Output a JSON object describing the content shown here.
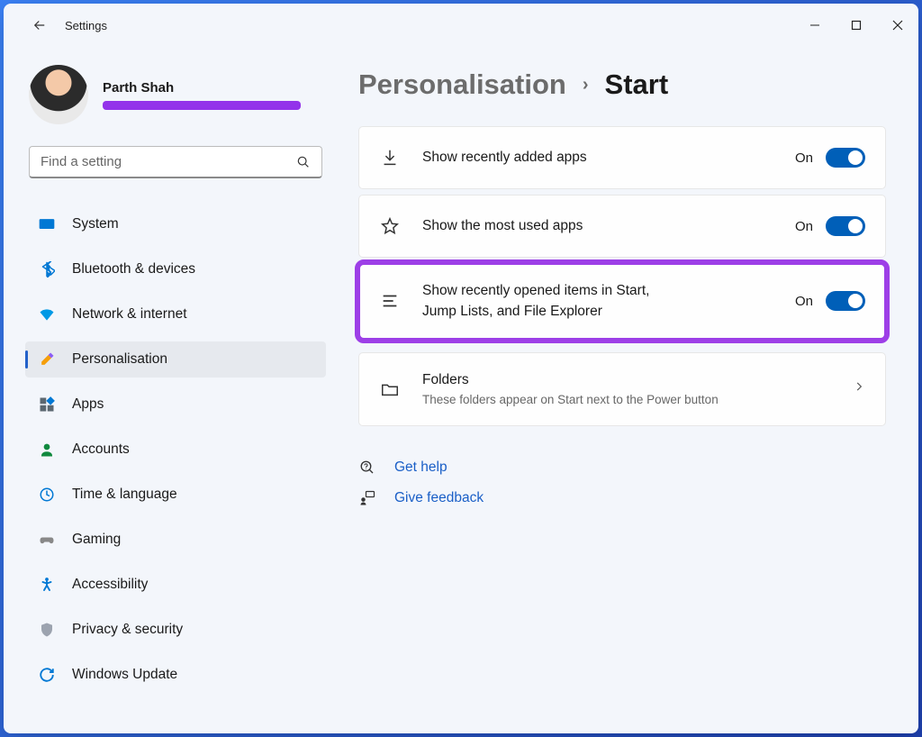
{
  "window": {
    "title": "Settings"
  },
  "profile": {
    "name": "Parth Shah"
  },
  "search": {
    "placeholder": "Find a setting"
  },
  "sidebar": {
    "items": [
      {
        "label": "System"
      },
      {
        "label": "Bluetooth & devices"
      },
      {
        "label": "Network & internet"
      },
      {
        "label": "Personalisation"
      },
      {
        "label": "Apps"
      },
      {
        "label": "Accounts"
      },
      {
        "label": "Time & language"
      },
      {
        "label": "Gaming"
      },
      {
        "label": "Accessibility"
      },
      {
        "label": "Privacy & security"
      },
      {
        "label": "Windows Update"
      }
    ]
  },
  "breadcrumb": {
    "parent": "Personalisation",
    "current": "Start"
  },
  "settings": {
    "recentlyAdded": {
      "label": "Show recently added apps",
      "state": "On"
    },
    "mostUsed": {
      "label": "Show the most used apps",
      "state": "On"
    },
    "recentItems": {
      "label": "Show recently opened items in Start, Jump Lists, and File Explorer",
      "state": "On"
    },
    "folders": {
      "label": "Folders",
      "sub": "These folders appear on Start next to the Power button"
    }
  },
  "links": {
    "help": "Get help",
    "feedback": "Give feedback"
  }
}
